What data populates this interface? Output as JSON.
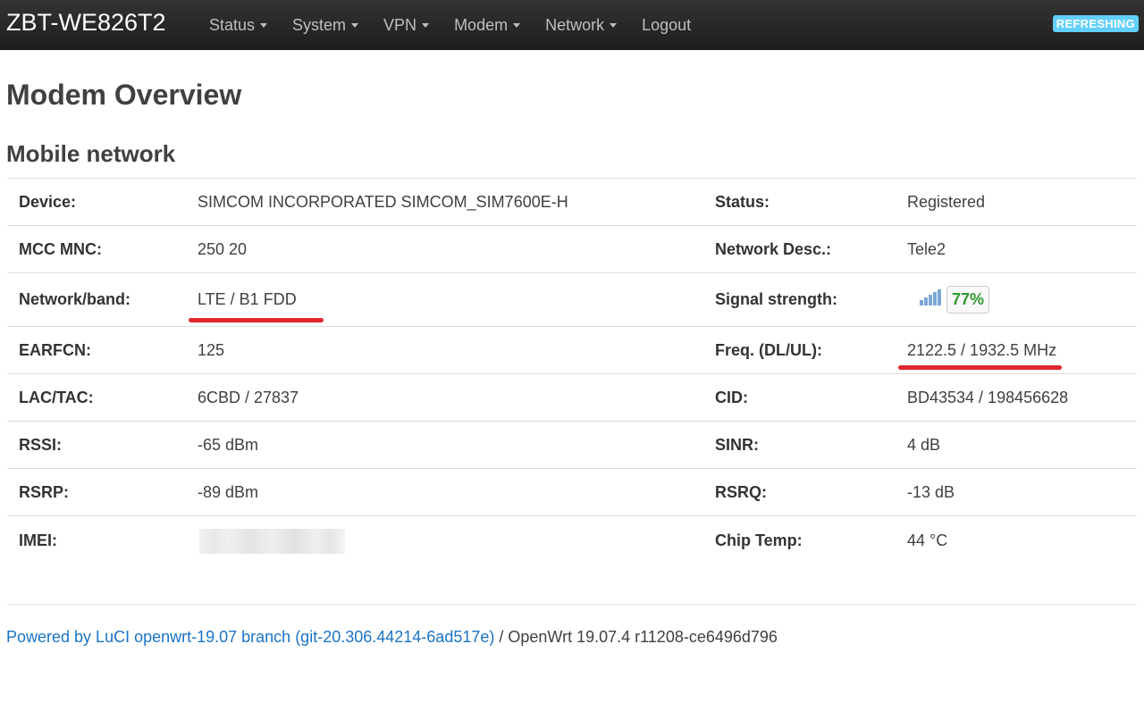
{
  "navbar": {
    "brand": "ZBT-WE826T2",
    "menu": [
      {
        "label": "Status",
        "dropdown": true
      },
      {
        "label": "System",
        "dropdown": true
      },
      {
        "label": "VPN",
        "dropdown": true
      },
      {
        "label": "Modem",
        "dropdown": true
      },
      {
        "label": "Network",
        "dropdown": true
      },
      {
        "label": "Logout",
        "dropdown": false
      }
    ],
    "refresh_badge": "REFRESHING"
  },
  "page": {
    "title": "Modem Overview",
    "section_title": "Mobile network"
  },
  "rows": [
    {
      "l1": "Device:",
      "v1": "SIMCOM INCORPORATED SIMCOM_SIM7600E-H",
      "l2": "Status:",
      "v2": "Registered"
    },
    {
      "l1": "MCC MNC:",
      "v1": "250 20",
      "l2": "Network Desc.:",
      "v2": "Tele2"
    },
    {
      "l1": "Network/band:",
      "v1": "LTE / B1 FDD",
      "l2": "Signal strength:",
      "v2": "77%"
    },
    {
      "l1": "EARFCN:",
      "v1": "125",
      "l2": "Freq. (DL/UL):",
      "v2": "2122.5 / 1932.5 MHz"
    },
    {
      "l1": "LAC/TAC:",
      "v1": "6CBD / 27837",
      "l2": "CID:",
      "v2": "BD43534 / 198456628"
    },
    {
      "l1": "RSSI:",
      "v1": "-65 dBm",
      "l2": "SINR:",
      "v2": "4 dB"
    },
    {
      "l1": "RSRP:",
      "v1": "-89 dBm",
      "l2": "RSRQ:",
      "v2": "-13 dB"
    },
    {
      "l1": "IMEI:",
      "v1": "",
      "l2": "Chip Temp:",
      "v2": "44 °C"
    }
  ],
  "signal": {
    "level_fraction": 0.77,
    "icon": "signal-bars-icon",
    "color": "#2e9a2e"
  },
  "footer": {
    "link_text": "Powered by LuCI openwrt-19.07 branch (git-20.306.44214-6ad517e)",
    "rest_text": " / OpenWrt 19.07.4 r11208-ce6496d796"
  },
  "colors": {
    "navbar": "#222222",
    "badge": "#62cffc",
    "link": "#1a73c8",
    "highlight_underline": "#e0262f"
  }
}
